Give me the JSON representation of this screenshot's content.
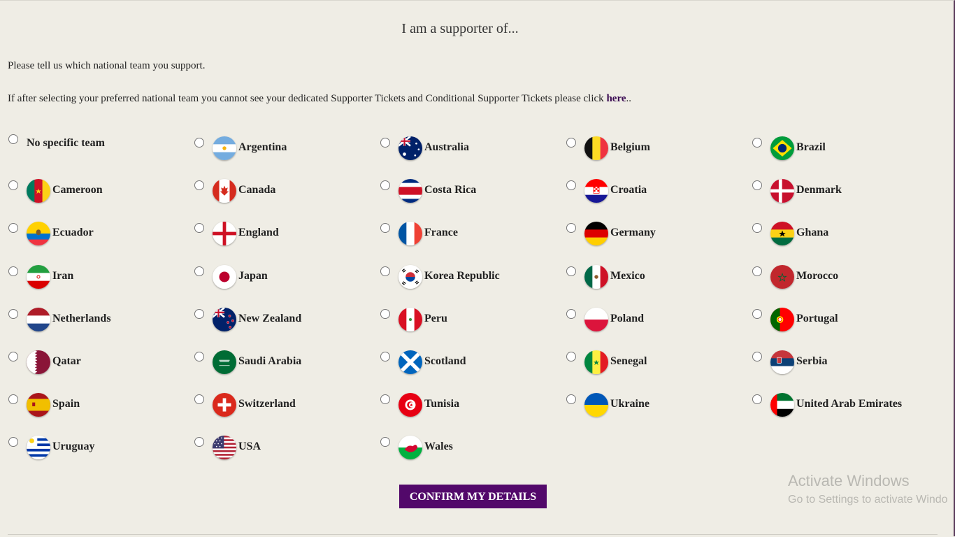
{
  "heading": "I am a supporter of...",
  "intro": "Please tell us which national team you support.",
  "note": {
    "before": "If after selecting your preferred national team you cannot see your dedicated Supporter Tickets and Conditional Supporter Tickets please click ",
    "link": "here",
    "after": ".."
  },
  "teams": [
    {
      "label": "No specific team",
      "flag": "none"
    },
    {
      "label": "Argentina",
      "flag": "argentina-flag"
    },
    {
      "label": "Australia",
      "flag": "australia-flag"
    },
    {
      "label": "Belgium",
      "flag": "belgium-flag"
    },
    {
      "label": "Brazil",
      "flag": "brazil-flag"
    },
    {
      "label": "Cameroon",
      "flag": "cameroon-flag"
    },
    {
      "label": "Canada",
      "flag": "canada-flag"
    },
    {
      "label": "Costa Rica",
      "flag": "costa-rica-flag"
    },
    {
      "label": "Croatia",
      "flag": "croatia-flag"
    },
    {
      "label": "Denmark",
      "flag": "denmark-flag"
    },
    {
      "label": "Ecuador",
      "flag": "ecuador-flag"
    },
    {
      "label": "England",
      "flag": "england-flag"
    },
    {
      "label": "France",
      "flag": "france-flag"
    },
    {
      "label": "Germany",
      "flag": "germany-flag"
    },
    {
      "label": "Ghana",
      "flag": "ghana-flag"
    },
    {
      "label": "Iran",
      "flag": "iran-flag"
    },
    {
      "label": "Japan",
      "flag": "japan-flag"
    },
    {
      "label": "Korea Republic",
      "flag": "korea-republic-flag"
    },
    {
      "label": "Mexico",
      "flag": "mexico-flag"
    },
    {
      "label": "Morocco",
      "flag": "morocco-flag"
    },
    {
      "label": "Netherlands",
      "flag": "netherlands-flag"
    },
    {
      "label": "New Zealand",
      "flag": "new-zealand-flag"
    },
    {
      "label": "Peru",
      "flag": "peru-flag"
    },
    {
      "label": "Poland",
      "flag": "poland-flag"
    },
    {
      "label": "Portugal",
      "flag": "portugal-flag"
    },
    {
      "label": "Qatar",
      "flag": "qatar-flag"
    },
    {
      "label": "Saudi Arabia",
      "flag": "saudi-arabia-flag"
    },
    {
      "label": "Scotland",
      "flag": "scotland-flag"
    },
    {
      "label": "Senegal",
      "flag": "senegal-flag"
    },
    {
      "label": "Serbia",
      "flag": "serbia-flag"
    },
    {
      "label": "Spain",
      "flag": "spain-flag"
    },
    {
      "label": "Switzerland",
      "flag": "switzerland-flag"
    },
    {
      "label": "Tunisia",
      "flag": "tunisia-flag"
    },
    {
      "label": "Ukraine",
      "flag": "ukraine-flag"
    },
    {
      "label": "United Arab Emirates",
      "flag": "uae-flag"
    },
    {
      "label": "Uruguay",
      "flag": "uruguay-flag"
    },
    {
      "label": "USA",
      "flag": "usa-flag"
    },
    {
      "label": "Wales",
      "flag": "wales-flag"
    }
  ],
  "confirm_label": "CONFIRM MY DETAILS",
  "watermark": {
    "line1": "Activate Windows",
    "line2": "Go to Settings to activate Windo"
  },
  "colors": {
    "background": "#efede5",
    "accent": "#52086a",
    "link": "#3a0a52"
  }
}
